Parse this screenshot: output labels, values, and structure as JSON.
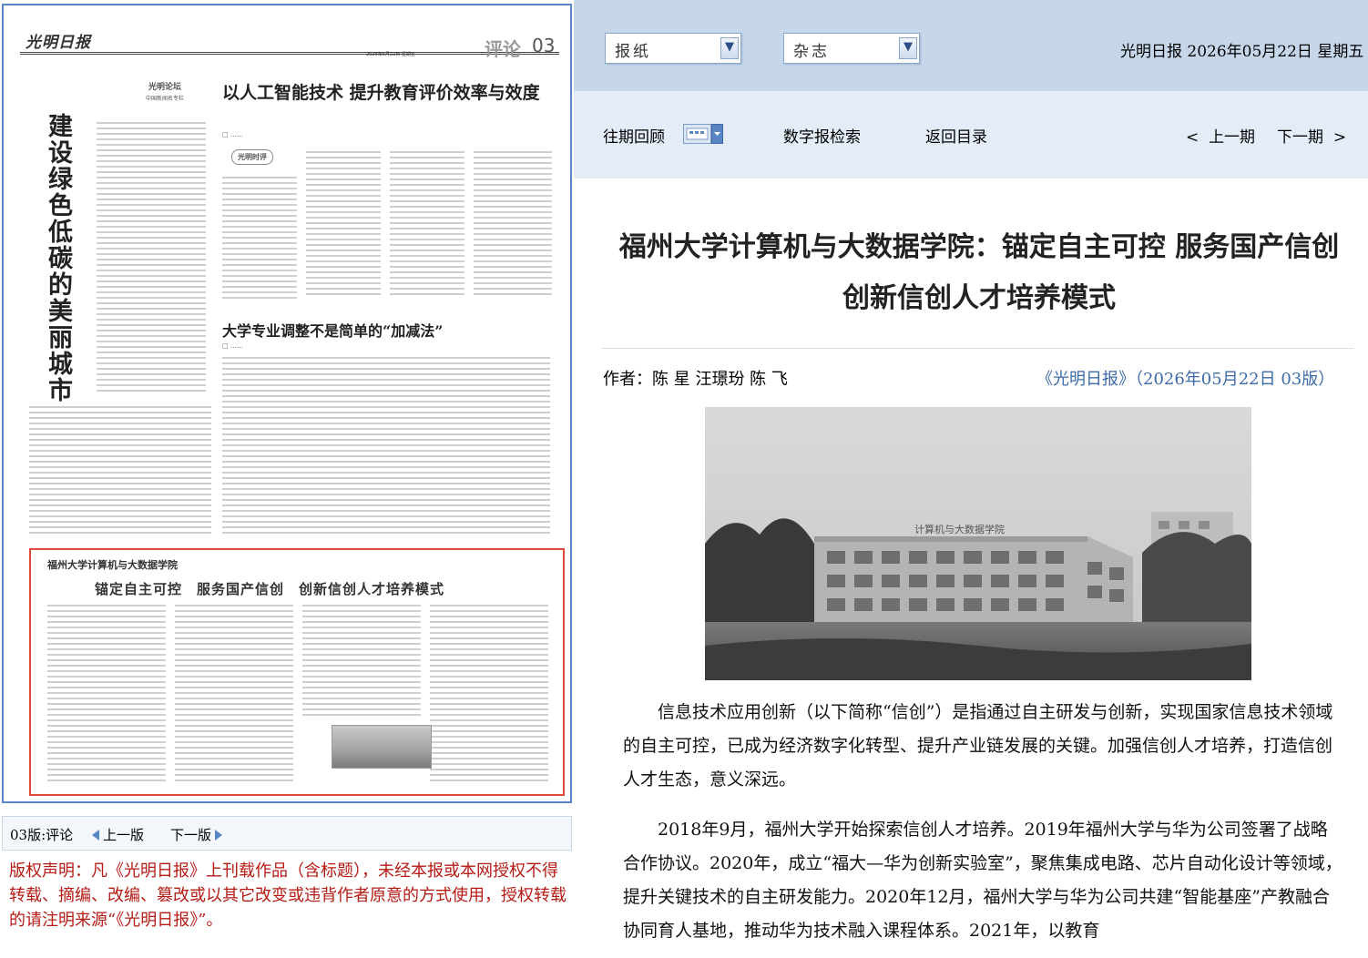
{
  "paper_page": {
    "logo": "光明日报",
    "dateline": "2026年5月22日 星期五",
    "section": "评论",
    "page_no": "03",
    "vertical_title": "建设绿色低碳的美丽城市",
    "vertical_author": "",
    "forum_logo": "光明论坛",
    "forum_sub": "中国新闻名专栏",
    "headline1": "以人工智能技术 提升教育评价效率与效度",
    "comment_tag": "光明时评",
    "headline2": "大学专业调整不是简单的“加减法”",
    "highlight_title1": "福州大学计算机与大数据学院",
    "highlight_title2": "锚定自主可控　服务国产信创　创新信创人才培养模式"
  },
  "footer_nav": {
    "edition": "03版:评论",
    "prev": "上一版",
    "next": "下一版"
  },
  "copyright": "版权声明：凡《光明日报》上刊载作品（含标题），未经本报或本网授权不得转载、摘编、改编、篡改或以其它改变或违背作者原意的方式使用，授权转载的请注明来源“《光明日报》”。",
  "top_bar": {
    "dropdown_newspaper": "报纸",
    "dropdown_magazine": "杂志",
    "date": "光明日报 2026年05月22日 星期五"
  },
  "sub_bar": {
    "past_issues": "往期回顾",
    "digital_search": "数字报检索",
    "back_to_index": "返回目录",
    "prev_issue": "上一期",
    "next_issue": "下一期"
  },
  "article": {
    "title": "福州大学计算机与大数据学院：锚定自主可控 服务国产信创 创新信创人才培养模式",
    "author_label": "作者：",
    "authors": "陈 星 汪璟玢 陈 飞",
    "source": "《光明日报》（2026年05月22日 03版）",
    "photo_sign": "计算机与大数据学院",
    "paragraphs": [
      "信息技术应用创新（以下简称“信创”）是指通过自主研发与创新，实现国家信息技术领域的自主可控，已成为经济数字化转型、提升产业链发展的关键。加强信创人才培养，打造信创人才生态，意义深远。",
      "2018年9月，福州大学开始探索信创人才培养。2019年福州大学与华为公司签署了战略合作协议。2020年，成立“福大—华为创新实验室”，聚焦集成电路、芯片自动化设计等领域，提升关键技术的自主研发能力。2020年12月，福州大学与华为公司共建“智能基座”产教融合协同育人基地，推动华为技术融入课程体系。2021年，以教育"
    ]
  },
  "colors": {
    "top_bar": "#c6d7ea",
    "sub_bar": "#e4edf7",
    "frame_border": "#5b86c5",
    "highlight_border": "#e44a3a",
    "copyright_text": "#b51b14",
    "source_link": "#3d6aa8"
  }
}
